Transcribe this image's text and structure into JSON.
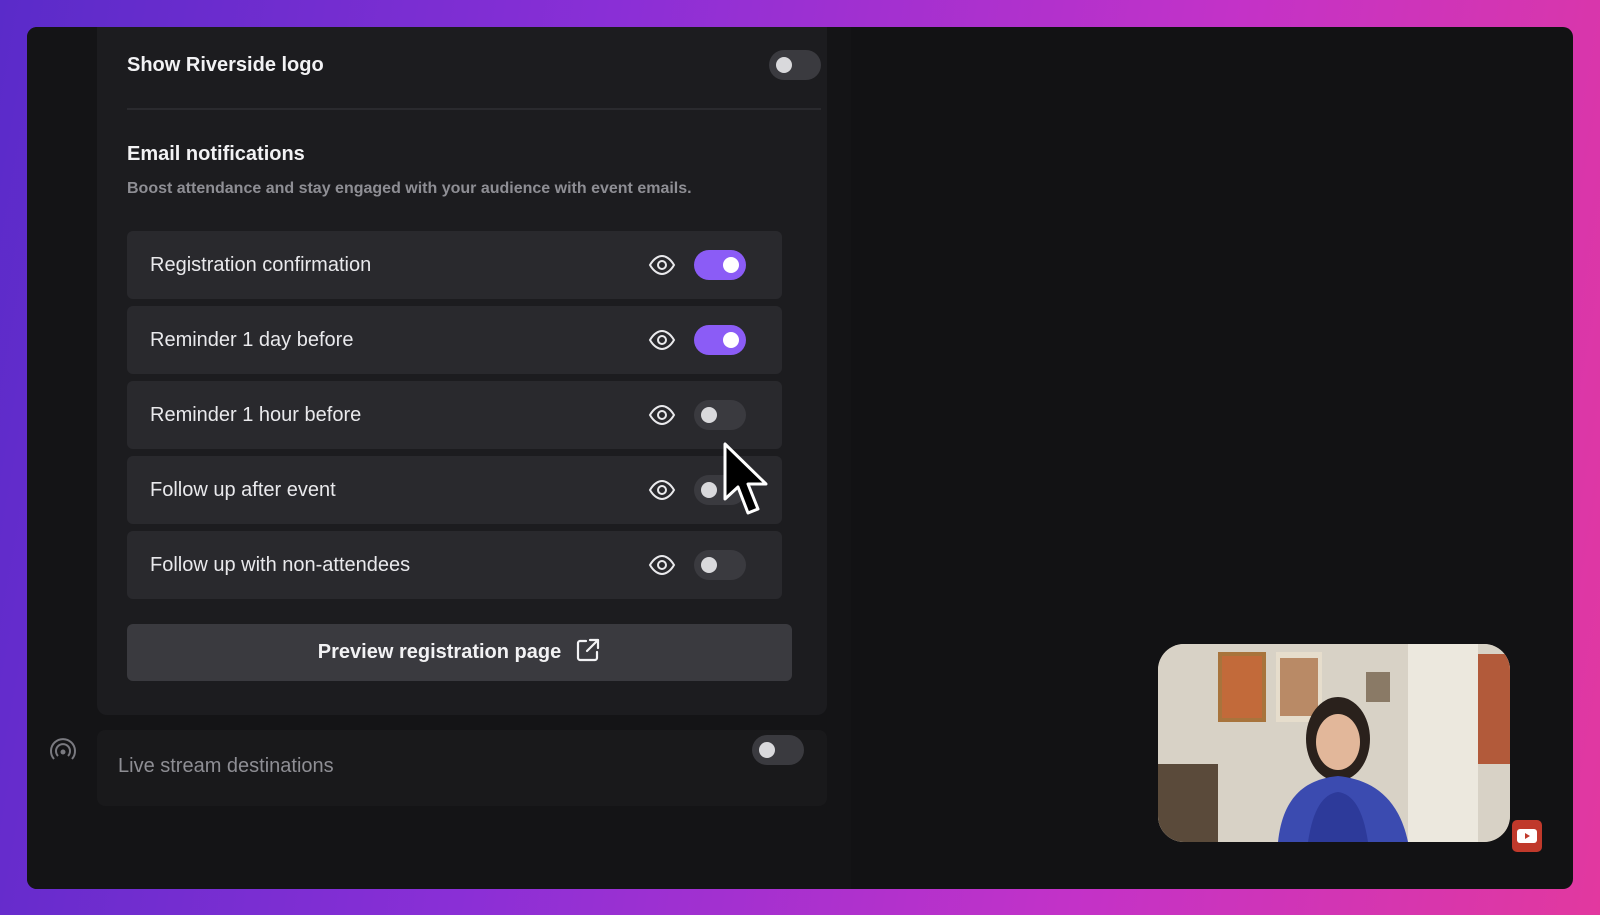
{
  "branding": {
    "show_logo_label": "Show Riverside logo",
    "show_logo_enabled": false
  },
  "email": {
    "title": "Email notifications",
    "subtitle": "Boost attendance and stay engaged with your audience with event emails.",
    "items": [
      {
        "label": "Registration confirmation",
        "enabled": true,
        "preview_icon": "eye-icon"
      },
      {
        "label": "Reminder 1 day before",
        "enabled": true,
        "preview_icon": "eye-icon"
      },
      {
        "label": "Reminder 1 hour before",
        "enabled": false,
        "preview_icon": "eye-icon"
      },
      {
        "label": "Follow up after event",
        "enabled": false,
        "preview_icon": "eye-icon"
      },
      {
        "label": "Follow up with non-attendees",
        "enabled": false,
        "preview_icon": "eye-icon"
      }
    ]
  },
  "preview_button": {
    "label": "Preview registration page",
    "icon": "external-link-icon"
  },
  "live_stream": {
    "label": "Live stream destinations",
    "icon": "broadcast-icon",
    "enabled": false
  },
  "colors": {
    "accent": "#8b5cf6",
    "panel": "#1c1c1f",
    "row": "#29292d"
  },
  "icons": {
    "cursor": "mouse-pointer-icon",
    "subscribe": "youtube-subscribe-icon"
  }
}
